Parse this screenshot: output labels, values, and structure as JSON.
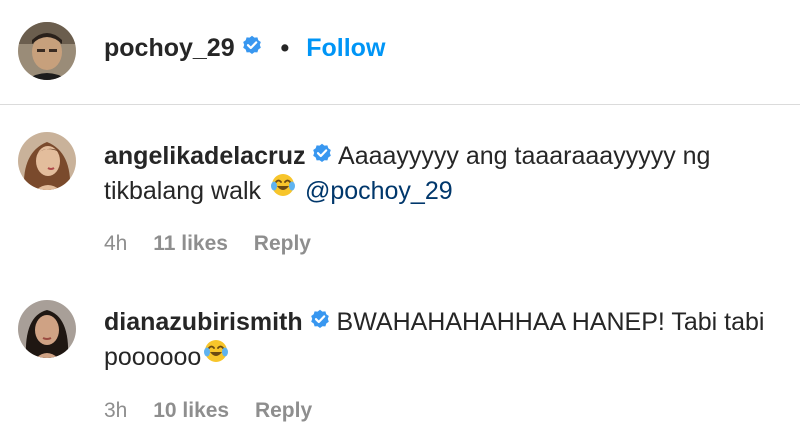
{
  "post_header": {
    "username": "pochoy_29",
    "separator": "•",
    "follow_label": "Follow"
  },
  "comments": [
    {
      "username": "angelikadelacruz",
      "text_before": "Aaaayyyyy ang taaaraaayyyyy ng tikbalang walk",
      "mention": "@pochoy_29",
      "time": "4h",
      "likes": "11 likes",
      "reply_label": "Reply"
    },
    {
      "username": "dianazubirismith",
      "text_before": "BWAHAHAHAHHAA HANEP! Tabi tabi poooooo",
      "mention": "",
      "time": "3h",
      "likes": "10 likes",
      "reply_label": "Reply"
    }
  ],
  "colors": {
    "follow": "#0095f6",
    "mention": "#00376b",
    "verified": "#3897f0",
    "meta": "#8e8e8e"
  },
  "icons": {
    "verified": "verified-badge-icon",
    "emoji": "face-with-tears-of-joy-emoji"
  }
}
